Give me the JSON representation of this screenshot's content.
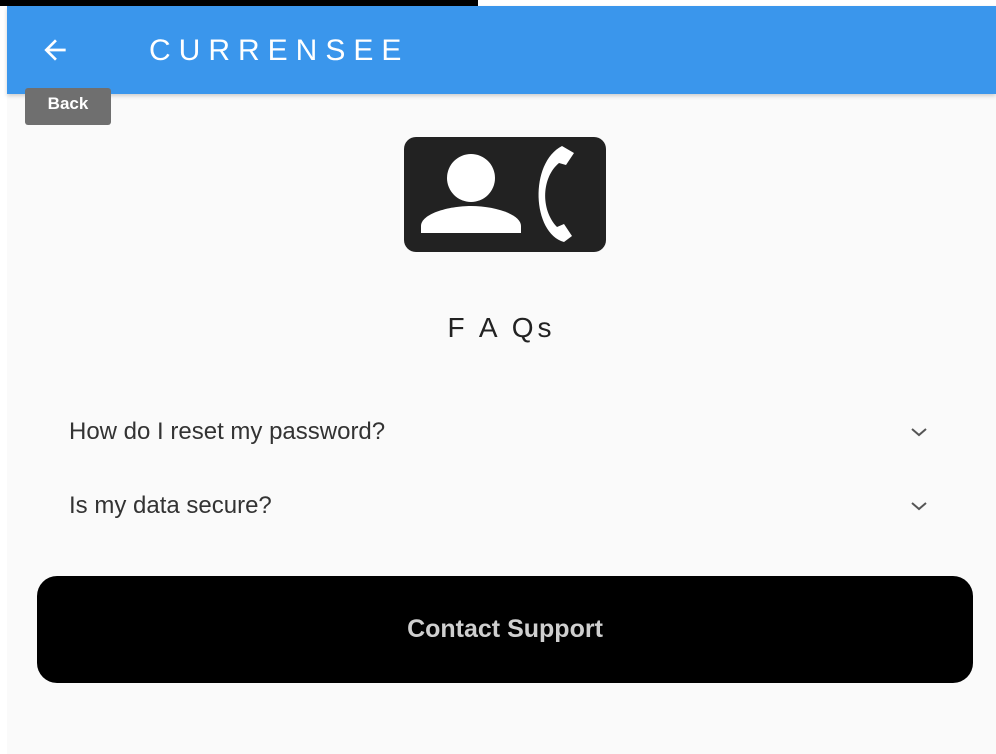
{
  "app_bar": {
    "title": "CURRENSEE",
    "back_icon": "arrow-left-icon",
    "background_color": "#3a96ec"
  },
  "tooltip": {
    "label": "Back"
  },
  "hero": {
    "icon": "contact-phone-icon"
  },
  "faq": {
    "title": "F A Qs",
    "items": [
      {
        "question": "How do I reset my password?",
        "icon": "chevron-down-icon"
      },
      {
        "question": "Is my data secure?",
        "icon": "chevron-down-icon"
      }
    ]
  },
  "contact_button": {
    "label": "Contact Support",
    "background_color": "#000000"
  }
}
